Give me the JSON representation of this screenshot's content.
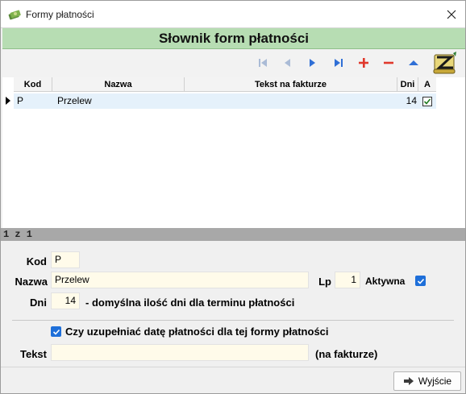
{
  "window": {
    "title": "Formy płatności"
  },
  "banner": {
    "title": "Słownik form płatności"
  },
  "grid": {
    "columns": [
      "Kod",
      "Nazwa",
      "Tekst na fakturze",
      "Dni",
      "A"
    ],
    "rows": [
      {
        "kod": "P",
        "nazwa": "Przelew",
        "tekst": "",
        "dni": "14",
        "aktywna": true
      }
    ]
  },
  "status": {
    "record_counter": "1 z 1"
  },
  "form": {
    "kod_label": "Kod",
    "kod_value": "P",
    "nazwa_label": "Nazwa",
    "nazwa_value": "Przelew",
    "lp_label": "Lp",
    "lp_value": "1",
    "aktywna_label": "Aktywna",
    "dni_label": "Dni",
    "dni_value": "14",
    "dni_hint": "- domyślna ilość dni dla terminu płatności",
    "uzupelniac_label": "Czy uzupełniać datę płatności dla tej formy płatności",
    "tekst_label": "Tekst",
    "tekst_value": "",
    "tekst_hint": "(na fakturze)"
  },
  "footer": {
    "exit_label": "Wyjście"
  },
  "colors": {
    "banner_bg": "#b7ddb3",
    "nav_blue": "#2f6fd6",
    "nav_red": "#e0382c",
    "field_bg": "#fffbea",
    "checkbox_blue": "#1e6fd9",
    "row_highlight": "#e5f1fb"
  },
  "icons": {
    "app": "money-icon",
    "close": "close-icon",
    "first": "first-record-icon",
    "prev": "prev-record-icon",
    "next": "next-record-icon",
    "last": "last-record-icon",
    "add": "add-icon",
    "delete": "delete-icon",
    "up": "up-icon",
    "logo": "scroll-z-icon",
    "exit": "exit-arrow-icon"
  }
}
